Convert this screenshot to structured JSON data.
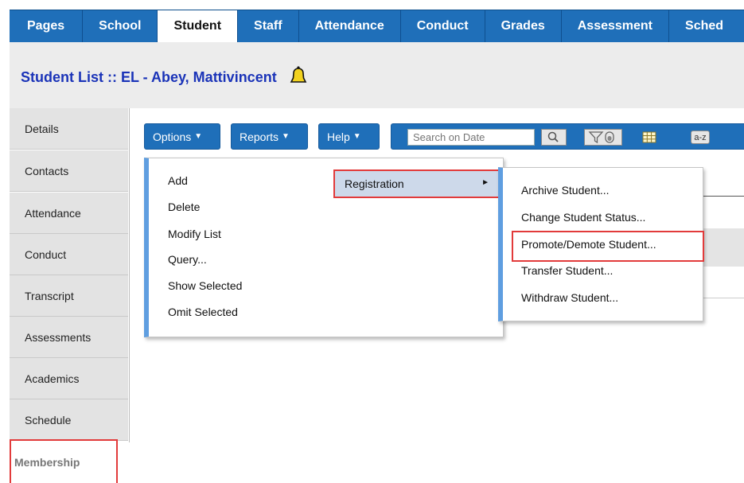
{
  "top_tabs": [
    {
      "label": "Pages"
    },
    {
      "label": "School"
    },
    {
      "label": "Student"
    },
    {
      "label": "Staff"
    },
    {
      "label": "Attendance"
    },
    {
      "label": "Conduct"
    },
    {
      "label": "Grades"
    },
    {
      "label": "Assessment"
    },
    {
      "label": "Sched"
    }
  ],
  "active_tab": "Student",
  "title": {
    "prefix": "Student List ::",
    "name": "EL - Abey, Mattivincent"
  },
  "sidebar": {
    "items": [
      {
        "label": "Details"
      },
      {
        "label": "Contacts"
      },
      {
        "label": "Attendance"
      },
      {
        "label": "Conduct"
      },
      {
        "label": "Transcript"
      },
      {
        "label": "Assessments"
      },
      {
        "label": "Academics"
      },
      {
        "label": "Schedule"
      }
    ],
    "membership": "Membership"
  },
  "toolbar": {
    "options_label": "Options",
    "reports_label": "Reports",
    "help_label": "Help",
    "search_placeholder": "Search on Date",
    "az_label": "a-z"
  },
  "options_menu": {
    "items": [
      "Add",
      "Delete",
      "Modify List",
      "Query...",
      "Show Selected",
      "Omit Selected"
    ],
    "registration_label": "Registration"
  },
  "registration_submenu": {
    "items": [
      "Archive Student...",
      "Change Student Status...",
      "Promote/Demote Student...",
      "Transfer Student...",
      "Withdraw Student..."
    ]
  },
  "colors": {
    "tab_bar": "#1f6fb9",
    "title_text": "#1a33b8",
    "highlight_border": "#e23b3b",
    "menu_accent": "#5f9ee0"
  }
}
